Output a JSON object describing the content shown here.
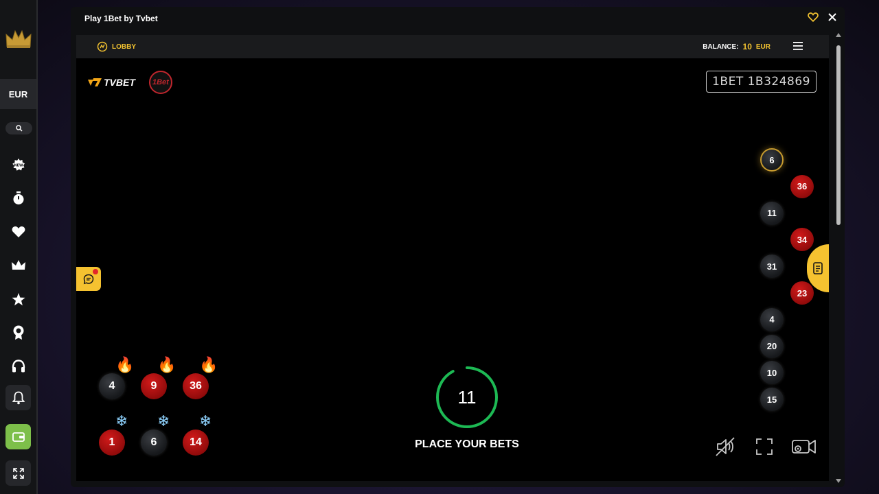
{
  "sidebar": {
    "currency": "EUR",
    "icons": [
      "crown-logo-icon",
      "search-icon",
      "new-badge-icon",
      "stopwatch-icon",
      "heart-icon",
      "crown-icon",
      "star-icon",
      "award-icon",
      "headset-icon",
      "bell-icon",
      "wallet-icon",
      "expand-icon"
    ],
    "accent_color": "#7dbf4a"
  },
  "window": {
    "title": "Play 1Bet by Tvbet"
  },
  "topbar": {
    "lobby_label": "LOBBY",
    "balance_label": "BALANCE:",
    "balance_amount": "10",
    "balance_currency": "EUR"
  },
  "brand": {
    "tvbet": "TVBET",
    "onebet": "1Bet"
  },
  "game_id": "1BET  1B324869",
  "hot_numbers": [
    {
      "number": "4",
      "color": "black"
    },
    {
      "number": "9",
      "color": "red"
    },
    {
      "number": "36",
      "color": "red"
    }
  ],
  "cold_numbers": [
    {
      "number": "1",
      "color": "red"
    },
    {
      "number": "6",
      "color": "black"
    },
    {
      "number": "14",
      "color": "red"
    }
  ],
  "history": [
    {
      "number": "6",
      "color": "black",
      "current": true
    },
    {
      "number": "36",
      "color": "red"
    },
    {
      "number": "11",
      "color": "black"
    },
    {
      "number": "34",
      "color": "red"
    },
    {
      "number": "31",
      "color": "black"
    },
    {
      "number": "23",
      "color": "red"
    },
    {
      "number": "4",
      "color": "black"
    },
    {
      "number": "20",
      "color": "black"
    },
    {
      "number": "10",
      "color": "black"
    },
    {
      "number": "15",
      "color": "black"
    }
  ],
  "timer": {
    "seconds": "11",
    "progress": 0.92,
    "color": "#1db954",
    "status": "PLACE YOUR BETS"
  },
  "colors": {
    "gold": "#f2c230",
    "red_ball": "#b01212",
    "black_ball": "#1e2024"
  }
}
